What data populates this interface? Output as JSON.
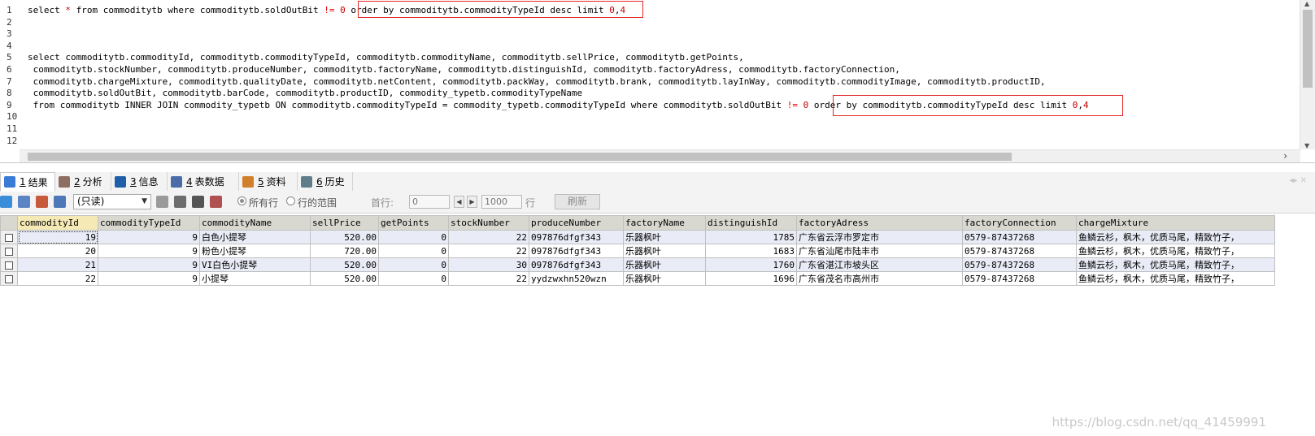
{
  "editor": {
    "line_numbers": [
      "1",
      "2",
      "3",
      "4",
      "5",
      "6",
      "7",
      "8",
      "9",
      "10",
      "11",
      "12"
    ],
    "lines": [
      [
        {
          "t": "select "
        },
        {
          "t": "*",
          "c": "kw"
        },
        {
          "t": " from commoditytb where commoditytb.soldOutBit "
        },
        {
          "t": "!=",
          "c": "kw"
        },
        {
          "t": " "
        },
        {
          "t": "0",
          "c": "num"
        },
        {
          "t": " order by commoditytb.commodityTypeId desc limit "
        },
        {
          "t": "0",
          "c": "num"
        },
        {
          "t": ","
        },
        {
          "t": "4",
          "c": "num"
        }
      ],
      [],
      [],
      [],
      [
        {
          "t": "select commoditytb.commodityId, commoditytb.commodityTypeId, commoditytb.commodityName, commoditytb.sellPrice, commoditytb.getPoints,"
        }
      ],
      [
        {
          "t": " commoditytb.stockNumber, commoditytb.produceNumber, commoditytb.factoryName, commoditytb.distinguishId, commoditytb.factoryAdress, commoditytb.factoryConnection,"
        }
      ],
      [
        {
          "t": " commoditytb.chargeMixture, commoditytb.qualityDate, commoditytb.netContent, commoditytb.packWay, commoditytb.brank, commoditytb.layInWay, commoditytb.commodityImage, commoditytb.productID,"
        }
      ],
      [
        {
          "t": " commoditytb.soldOutBit, commoditytb.barCode, commoditytb.productID, commodity_typetb.commodityTypeName"
        }
      ],
      [
        {
          "t": " from commoditytb INNER JOIN commodity_typetb ON commoditytb.commodityTypeId = commodity_typetb.commodityTypeId where commoditytb.soldOutBit "
        },
        {
          "t": "!=",
          "c": "kw"
        },
        {
          "t": " "
        },
        {
          "t": "0",
          "c": "num"
        },
        {
          "t": " order by commoditytb.commodityTypeId desc limit "
        },
        {
          "t": "0",
          "c": "num"
        },
        {
          "t": ","
        },
        {
          "t": "4",
          "c": "num"
        }
      ],
      [],
      [],
      []
    ]
  },
  "tabs": [
    {
      "key": "1",
      "label": "结果",
      "icon_name": "result-table-icon",
      "active": true
    },
    {
      "key": "2",
      "label": "分析",
      "icon_name": "profile-analysis-icon",
      "active": false
    },
    {
      "key": "3",
      "label": "信息",
      "icon_name": "info-icon",
      "active": false
    },
    {
      "key": "4",
      "label": "表数据",
      "icon_name": "table-data-icon",
      "active": false
    },
    {
      "key": "5",
      "label": "资料",
      "icon_name": "objects-info-icon",
      "active": false
    },
    {
      "key": "6",
      "label": "历史",
      "icon_name": "history-calendar-icon",
      "active": false
    }
  ],
  "toolbar": {
    "mode_select_value": "(只读)",
    "radio_all_rows": "所有行",
    "radio_row_range": "行的范围",
    "first_row_label": "首行:",
    "first_row_value": "0",
    "row_count_value": "1000",
    "rows_unit_label": "行",
    "refresh_label": "刷新"
  },
  "grid": {
    "columns": [
      "commodityId",
      "commodityTypeId",
      "commodityName",
      "sellPrice",
      "getPoints",
      "stockNumber",
      "produceNumber",
      "factoryName",
      "distinguishId",
      "factoryAdress",
      "factoryConnection",
      "chargeMixture"
    ],
    "numeric_columns": [
      0,
      1,
      3,
      4,
      5,
      8
    ],
    "rows": [
      [
        "19",
        "9",
        "白色小提琴",
        "520.00",
        "0",
        "22",
        "097876dfgf343",
        "乐器枫叶",
        "1785",
        "广东省云浮市罗定市",
        "0579-87437268",
        "鱼鳞云杉，枫木，优质马尾，精致竹子，"
      ],
      [
        "20",
        "9",
        "粉色小提琴",
        "720.00",
        "0",
        "22",
        "097876dfgf343",
        "乐器枫叶",
        "1683",
        "广东省汕尾市陆丰市",
        "0579-87437268",
        "鱼鳞云杉，枫木，优质马尾，精致竹子，"
      ],
      [
        "21",
        "9",
        "VI白色小提琴",
        "520.00",
        "0",
        "30",
        "097876dfgf343",
        "乐器枫叶",
        "1760",
        "广东省湛江市坡头区",
        "0579-87437268",
        "鱼鳞云杉，枫木，优质马尾，精致竹子，"
      ],
      [
        "22",
        "9",
        "小提琴",
        "520.00",
        "0",
        "22",
        "yydzwxhn520wzn",
        "乐器枫叶",
        "1696",
        "广东省茂名市高州市",
        "0579-87437268",
        "鱼鳞云杉，枫木，优质马尾，精致竹子，"
      ]
    ]
  },
  "watermark": "https://blog.csdn.net/qq_41459991",
  "colors": {
    "highlight_box": "#e32727",
    "keyword": "#e00000",
    "number": "#c80000",
    "sorted_header": "#f5e9b6",
    "row_alt": "#e9ecf6"
  }
}
